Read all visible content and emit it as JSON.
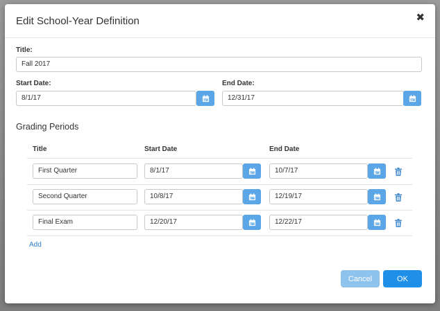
{
  "dialog": {
    "title": "Edit School-Year Definition",
    "close_glyph": "✖"
  },
  "form": {
    "title_label": "Title:",
    "title_value": "Fall 2017",
    "start_label": "Start Date:",
    "start_value": "8/1/17",
    "end_label": "End Date:",
    "end_value": "12/31/17"
  },
  "grading": {
    "section_title": "Grading Periods",
    "columns": [
      "Title",
      "Start Date",
      "End Date"
    ],
    "rows": [
      {
        "title": "First Quarter",
        "start": "8/1/17",
        "end": "10/7/17"
      },
      {
        "title": "Second Quarter",
        "start": "10/8/17",
        "end": "12/19/17"
      },
      {
        "title": "Final Exam",
        "start": "12/20/17",
        "end": "12/22/17"
      }
    ],
    "add_label": "Add"
  },
  "footer": {
    "cancel_label": "Cancel",
    "ok_label": "OK"
  },
  "icons": {
    "calendar": "calendar-icon",
    "trash": "trash-icon",
    "close": "close-icon"
  },
  "colors": {
    "accent": "#1f8fe8",
    "calendar_button": "#5aa6e6",
    "cancel_button": "#8ec3ee",
    "link": "#2b7cc1",
    "trash": "#4a8fd0"
  }
}
